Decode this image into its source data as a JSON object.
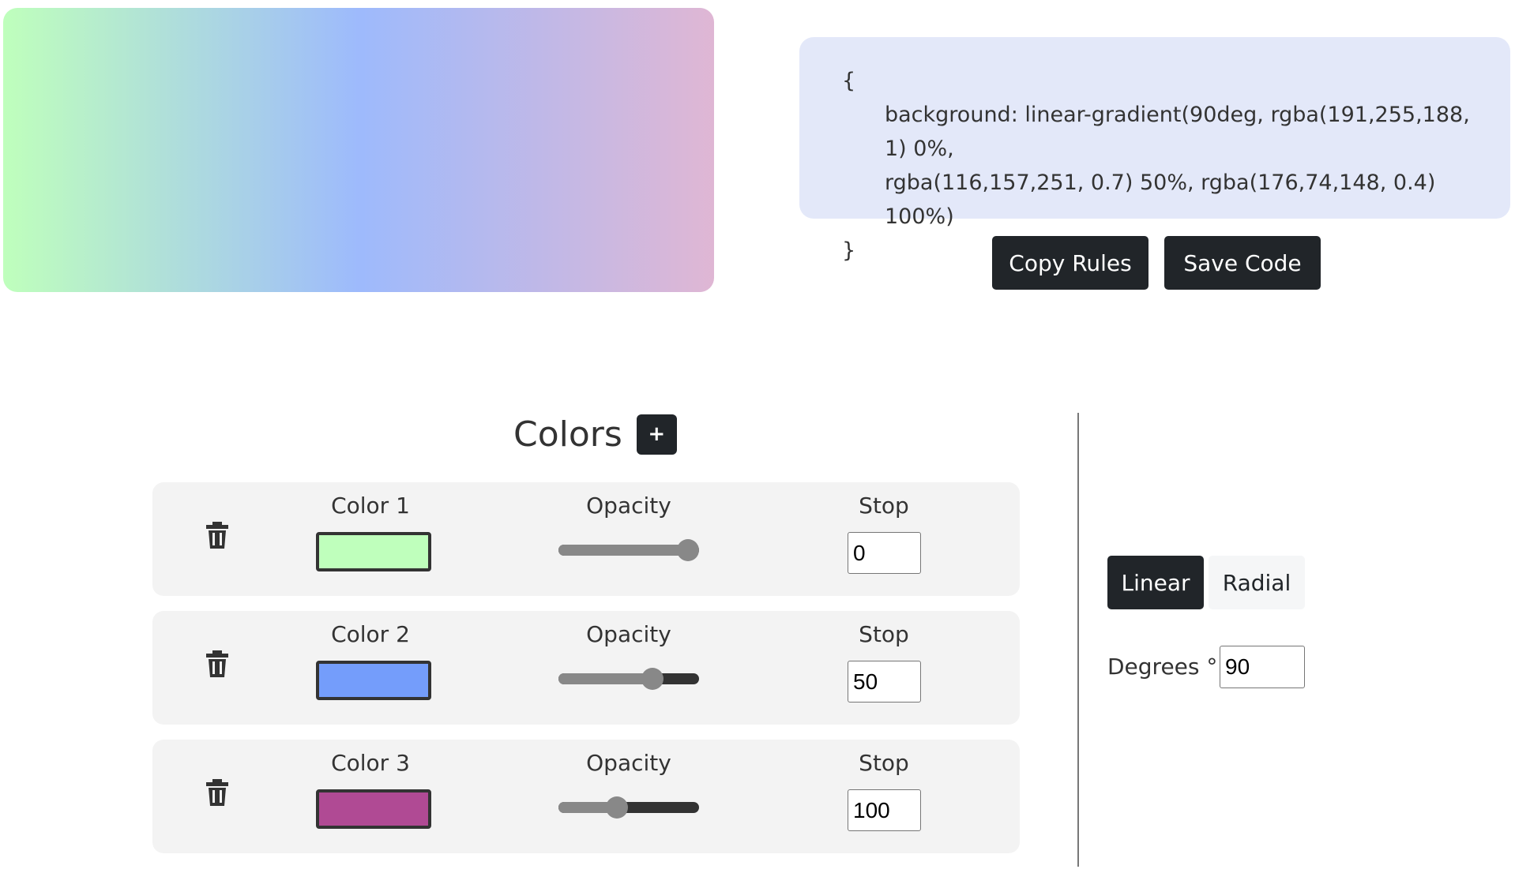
{
  "preview": {
    "type": "linear",
    "degrees": 90
  },
  "code": {
    "open": "{",
    "line1": "background: linear-gradient(90deg, rgba(191,255,188, 1) 0%,",
    "line2": "rgba(116,157,251, 0.7) 50%, rgba(176,74,148, 0.4) 100%)",
    "close": "}"
  },
  "actions": {
    "copy_label": "Copy Rules",
    "save_label": "Save Code"
  },
  "colors_section": {
    "title": "Colors",
    "add_label": "+",
    "opacity_label": "Opacity",
    "stop_label": "Stop",
    "items": [
      {
        "label": "Color 1",
        "hex": "#bfffbc",
        "rgb": [
          191,
          255,
          188
        ],
        "opacity": 1,
        "stop": "0"
      },
      {
        "label": "Color 2",
        "hex": "#749dfb",
        "rgb": [
          116,
          157,
          251
        ],
        "opacity": 0.7,
        "stop": "50"
      },
      {
        "label": "Color 3",
        "hex": "#b04a94",
        "rgb": [
          176,
          74,
          148
        ],
        "opacity": 0.4,
        "stop": "100"
      }
    ]
  },
  "gradient_type": {
    "linear_label": "Linear",
    "radial_label": "Radial",
    "selected": "Linear"
  },
  "degrees": {
    "label": "Degrees °",
    "value": "90"
  },
  "icons": {
    "delete": "trash-icon",
    "add": "plus-icon"
  }
}
